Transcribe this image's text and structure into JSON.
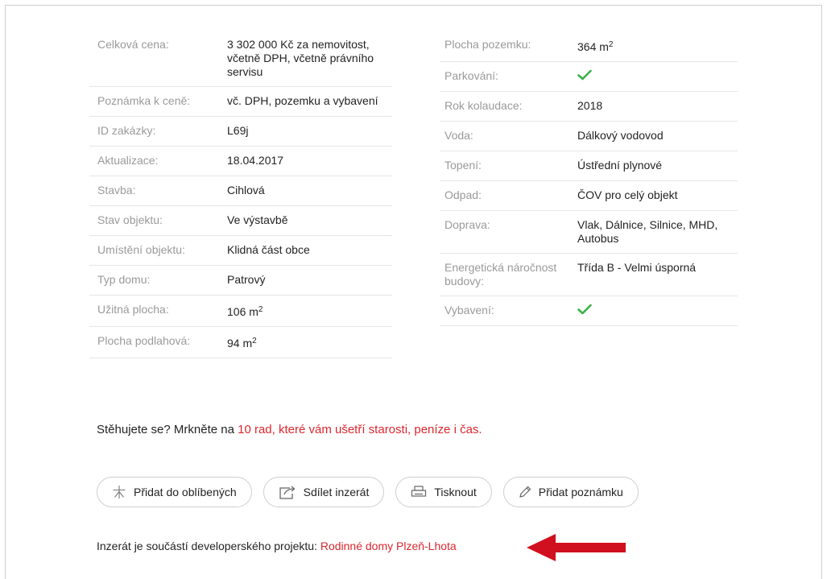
{
  "left_params": [
    {
      "label": "Celková cena:",
      "value": "3 302 000 Kč za nemovitost, včetně DPH, včetně právního servisu"
    },
    {
      "label": "Poznámka k ceně:",
      "value": "vč. DPH, pozemku a vybavení"
    },
    {
      "label": "ID zakázky:",
      "value": "L69j"
    },
    {
      "label": "Aktualizace:",
      "value": "18.04.2017"
    },
    {
      "label": "Stavba:",
      "value": "Cihlová"
    },
    {
      "label": "Stav objektu:",
      "value": "Ve výstavbě"
    },
    {
      "label": "Umístění objektu:",
      "value": "Klidná část obce"
    },
    {
      "label": "Typ domu:",
      "value": "Patrový"
    },
    {
      "label": "Užitná plocha:",
      "value": "106 m",
      "sup": "2"
    },
    {
      "label": "Plocha podlahová:",
      "value": "94 m",
      "sup": "2"
    }
  ],
  "right_params": [
    {
      "label": "Plocha pozemku:",
      "value": "364 m",
      "sup": "2"
    },
    {
      "label": "Parkování:",
      "check": true
    },
    {
      "label": "Rok kolaudace:",
      "value": "2018"
    },
    {
      "label": "Voda:",
      "value": "Dálkový vodovod"
    },
    {
      "label": "Topení:",
      "value": "Ústřední plynové"
    },
    {
      "label": "Odpad:",
      "value": "ČOV pro celý objekt"
    },
    {
      "label": "Doprava:",
      "value": "Vlak, Dálnice, Silnice, MHD, Autobus"
    },
    {
      "label": "Energetická náročnost budovy:",
      "value": "Třída B - Velmi úsporná"
    },
    {
      "label": "Vybavení:",
      "check": true
    }
  ],
  "tip": {
    "text": "Stěhujete se? Mrkněte na ",
    "link": "10 rad, které vám ušetří starosti, peníze i čas."
  },
  "buttons": {
    "favorite": "Přidat do oblíbených",
    "share": "Sdílet inzerát",
    "print": "Tisknout",
    "note": "Přidat poznámku"
  },
  "project": {
    "text": "Inzerát je součástí developerského projektu: ",
    "link": "Rodinné domy Plzeň-Lhota"
  },
  "colors": {
    "accent": "#d9282f",
    "check": "#3bb34a",
    "arrow": "#d0101e"
  }
}
